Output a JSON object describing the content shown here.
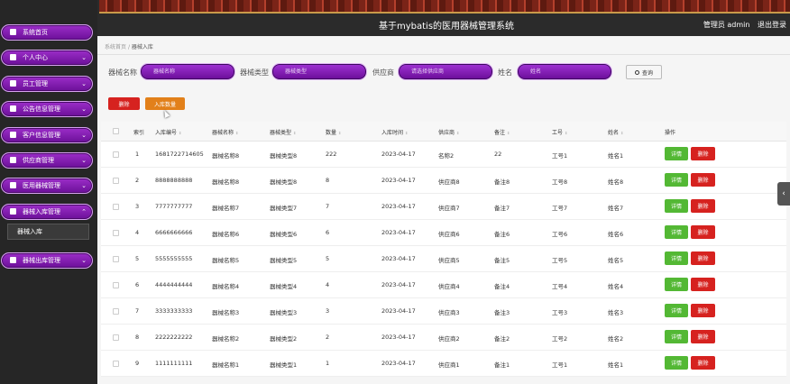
{
  "header": {
    "title": "基于mybatis的医用器械管理系统",
    "user": "管理员 admin",
    "logout": "退出登录"
  },
  "sidebar": {
    "items": [
      {
        "label": "系统首页",
        "icon": "home-icon",
        "caret": ""
      },
      {
        "label": "个人中心",
        "icon": "user-icon",
        "caret": "⌄"
      },
      {
        "label": "员工管理",
        "icon": "staff-icon",
        "caret": "⌄"
      },
      {
        "label": "公告信息管理",
        "icon": "notice-icon",
        "caret": "⌄"
      },
      {
        "label": "客户信息管理",
        "icon": "customer-icon",
        "caret": "⌄"
      },
      {
        "label": "供应商管理",
        "icon": "supplier-icon",
        "caret": "⌄"
      },
      {
        "label": "医用器械管理",
        "icon": "device-icon",
        "caret": "⌄"
      },
      {
        "label": "器械入库管理",
        "icon": "stock-in-icon",
        "caret": "⌃"
      },
      {
        "label": "器械出库管理",
        "icon": "stock-out-icon",
        "caret": "⌄"
      }
    ],
    "sub_active": "器械入库"
  },
  "breadcrumb": {
    "home": "系统首页",
    "sep": "/",
    "current": "器械入库"
  },
  "search": {
    "label1": "器械名称",
    "ph1": "器械名称",
    "label2": "器械类型",
    "ph2": "器械类型",
    "label3": "供应商",
    "ph3": "请选择供应商",
    "label4": "姓名",
    "ph4": "姓名",
    "button": "查询"
  },
  "actions": {
    "delete": "删除",
    "quantity": "入库数量"
  },
  "table": {
    "headers": [
      "索引",
      "入库编号",
      "器械名称",
      "器械类型",
      "数量",
      "入库时间",
      "供应商",
      "备注",
      "工号",
      "姓名",
      "操作"
    ],
    "detail_label": "详情",
    "delete_label": "删除",
    "rows": [
      {
        "idx": "1",
        "code": "1681722714605",
        "name": "器械名称8",
        "type": "器械类型8",
        "qty": "222",
        "time": "2023-04-17",
        "supplier": "名称2",
        "note": "22",
        "job": "工号1",
        "person": "姓名1"
      },
      {
        "idx": "2",
        "code": "8888888888",
        "name": "器械名称8",
        "type": "器械类型8",
        "qty": "8",
        "time": "2023-04-17",
        "supplier": "供应商8",
        "note": "备注8",
        "job": "工号8",
        "person": "姓名8"
      },
      {
        "idx": "3",
        "code": "7777777777",
        "name": "器械名称7",
        "type": "器械类型7",
        "qty": "7",
        "time": "2023-04-17",
        "supplier": "供应商7",
        "note": "备注7",
        "job": "工号7",
        "person": "姓名7"
      },
      {
        "idx": "4",
        "code": "6666666666",
        "name": "器械名称6",
        "type": "器械类型6",
        "qty": "6",
        "time": "2023-04-17",
        "supplier": "供应商6",
        "note": "备注6",
        "job": "工号6",
        "person": "姓名6"
      },
      {
        "idx": "5",
        "code": "5555555555",
        "name": "器械名称5",
        "type": "器械类型5",
        "qty": "5",
        "time": "2023-04-17",
        "supplier": "供应商5",
        "note": "备注5",
        "job": "工号5",
        "person": "姓名5"
      },
      {
        "idx": "6",
        "code": "4444444444",
        "name": "器械名称4",
        "type": "器械类型4",
        "qty": "4",
        "time": "2023-04-17",
        "supplier": "供应商4",
        "note": "备注4",
        "job": "工号4",
        "person": "姓名4"
      },
      {
        "idx": "7",
        "code": "3333333333",
        "name": "器械名称3",
        "type": "器械类型3",
        "qty": "3",
        "time": "2023-04-17",
        "supplier": "供应商3",
        "note": "备注3",
        "job": "工号3",
        "person": "姓名3"
      },
      {
        "idx": "8",
        "code": "2222222222",
        "name": "器械名称2",
        "type": "器械类型2",
        "qty": "2",
        "time": "2023-04-17",
        "supplier": "供应商2",
        "note": "备注2",
        "job": "工号2",
        "person": "姓名2"
      },
      {
        "idx": "9",
        "code": "1111111111",
        "name": "器械名称1",
        "type": "器械类型1",
        "qty": "1",
        "time": "2023-04-17",
        "supplier": "供应商1",
        "note": "备注1",
        "job": "工号1",
        "person": "姓名1"
      }
    ]
  },
  "colors": {
    "purple": "#7a1aa8",
    "danger": "#d6221f",
    "success": "#53b834",
    "warning": "#e2801a"
  }
}
